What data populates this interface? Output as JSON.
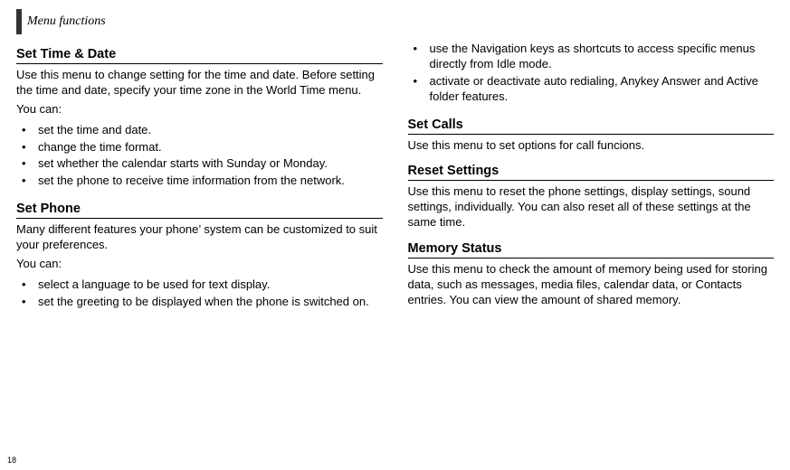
{
  "header": {
    "title": "Menu functions"
  },
  "page_number": "18",
  "left": {
    "section1": {
      "heading": "Set Time & Date",
      "para": "Use this menu to change setting for the time and date. Before setting the time and date, specify your time zone in the World Time menu.",
      "intro": "You can:",
      "bullets": [
        "set the time and date.",
        "change the time format.",
        "set whether the calendar starts with Sunday or Monday.",
        "set the phone to receive time information from the network."
      ]
    },
    "section2": {
      "heading": "Set Phone",
      "para": "Many different features your phone’ system can be customized to suit your preferences.",
      "intro": "You can:",
      "bullets": [
        "select a language to be used for text display.",
        "set the greeting to be displayed when the phone is switched on."
      ]
    }
  },
  "right": {
    "cont_bullets": [
      "use the Navigation keys as shortcuts to access specific menus directly from Idle mode.",
      "activate or deactivate auto redialing, Anykey Answer and Active folder features."
    ],
    "section3": {
      "heading": "Set Calls",
      "para": "Use this menu to set options for call funcions."
    },
    "section4": {
      "heading": "Reset Settings",
      "para": "Use this menu to reset the phone settings, display settings, sound settings, individually. You can also reset all of these settings at the same time."
    },
    "section5": {
      "heading": "Memory Status",
      "para": "Use this menu to check the amount of memory being used for storing data, such as messages, media files, calendar data, or Contacts entries. You can view the amount of shared memory."
    }
  }
}
